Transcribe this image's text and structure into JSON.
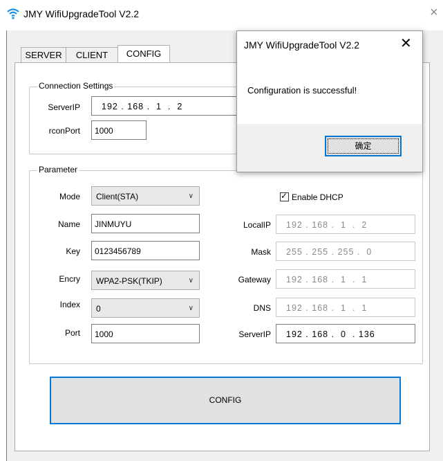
{
  "window": {
    "title": "JMY WifiUpgradeTool V2.2",
    "close": "×"
  },
  "tabs": [
    {
      "label": "SERVER"
    },
    {
      "label": "CLIENT"
    },
    {
      "label": "CONFIG"
    }
  ],
  "connection": {
    "title": "Connection Settings",
    "server_ip_label": "ServerIP",
    "server_ip": [
      "192",
      "168",
      "1",
      "2"
    ],
    "rcon_port_label": "rconPort",
    "rcon_port": "1000"
  },
  "parameter": {
    "title": "Parameter",
    "mode_label": "Mode",
    "mode": "Client(STA)",
    "name_label": "Name",
    "name": "JINMUYU",
    "key_label": "Key",
    "key": "0123456789",
    "encry_label": "Encry",
    "encry": "WPA2-PSK(TKIP)",
    "index_label": "Index",
    "index": "0",
    "port_label": "Port",
    "port": "1000",
    "dhcp_label": "Enable DHCP",
    "dhcp_checked": true,
    "localip_label": "LocalIP",
    "localip": [
      "192",
      "168",
      "1",
      "2"
    ],
    "mask_label": "Mask",
    "mask": [
      "255",
      "255",
      "255",
      "0"
    ],
    "gateway_label": "Gateway",
    "gateway": [
      "192",
      "168",
      "1",
      "1"
    ],
    "dns_label": "DNS",
    "dns": [
      "192",
      "168",
      "1",
      "1"
    ],
    "serverip_label": "ServerIP",
    "serverip": [
      "192",
      "168",
      "0",
      "136"
    ]
  },
  "config_button": "CONFIG",
  "dialog": {
    "title": "JMY WifiUpgradeTool V2.2",
    "close": "✕",
    "message": "Configuration is successful!",
    "ok": "确定"
  },
  "colors": {
    "accent": "#0078d7",
    "wifi_icon": "#1e90e6"
  }
}
